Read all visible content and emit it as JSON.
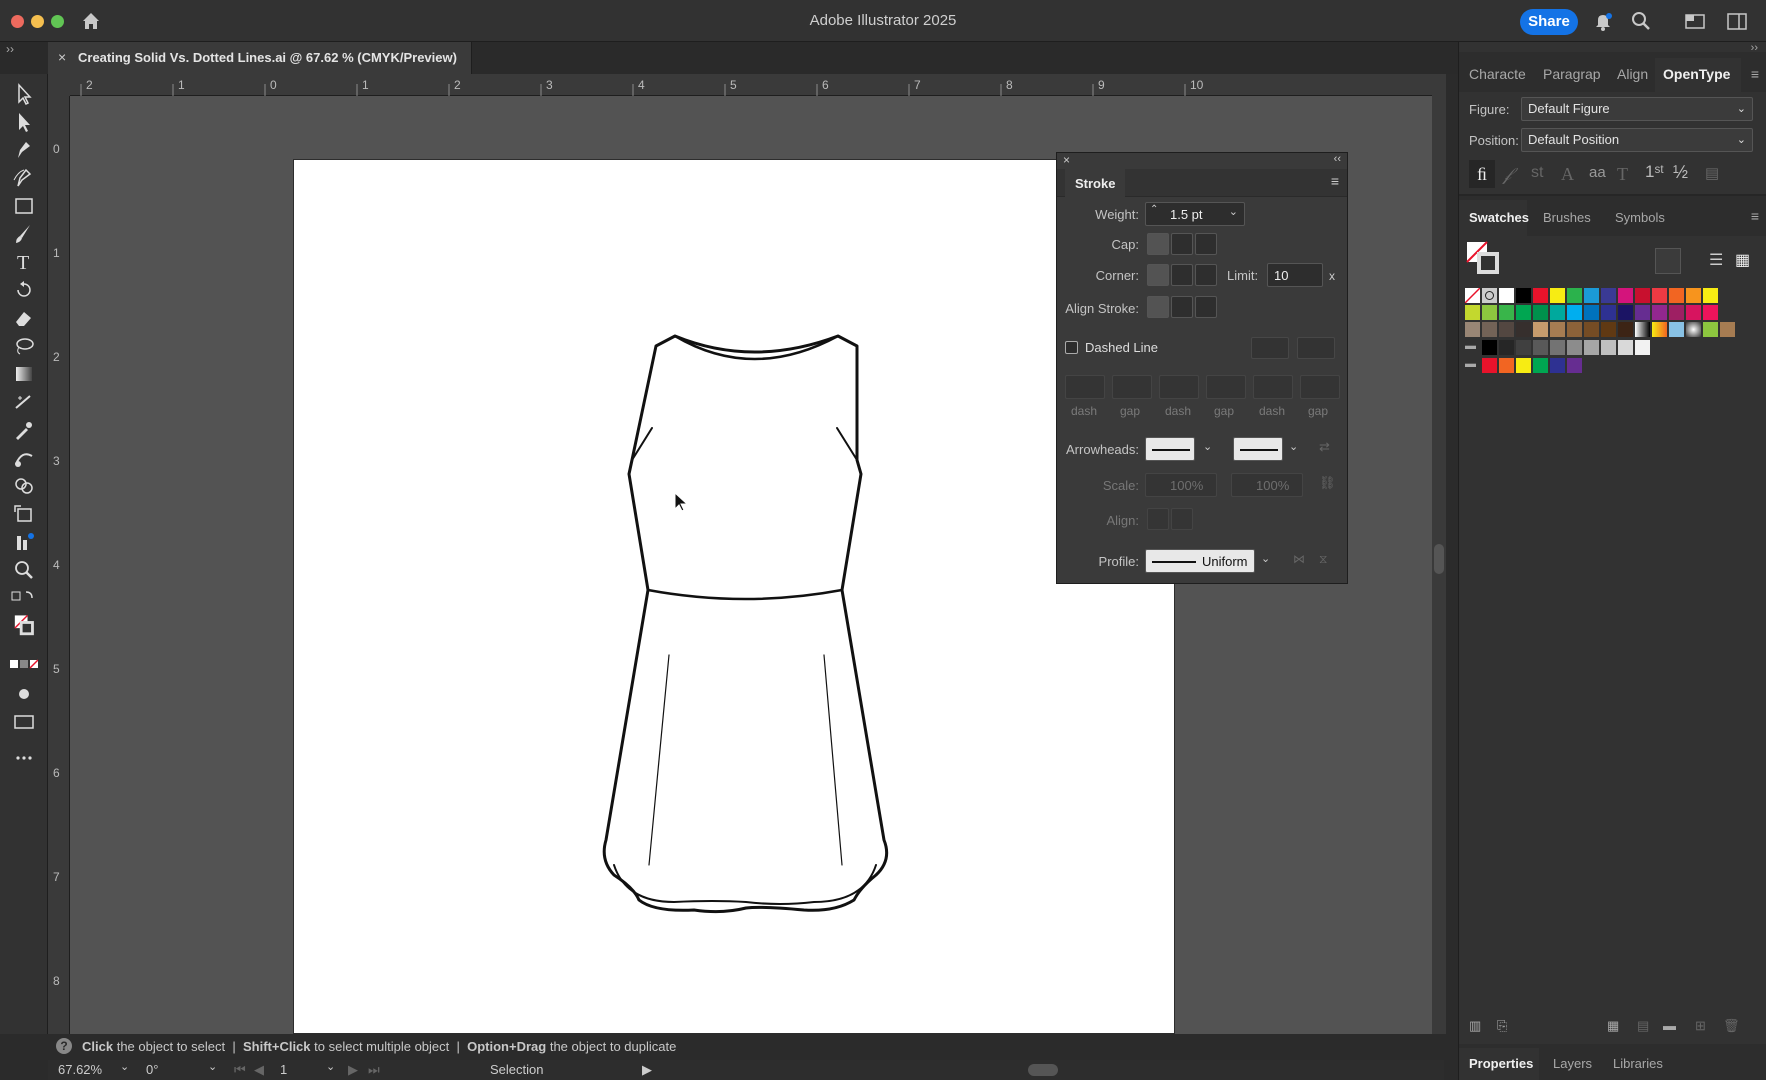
{
  "window": {
    "title": "Adobe Illustrator 2025",
    "share_label": "Share"
  },
  "document_tab": {
    "close": "×",
    "title": "Creating Solid Vs. Dotted Lines.ai @ 67.62 % (CMYK/Preview)"
  },
  "rulers": {
    "top": [
      "2",
      "1",
      "0",
      "1",
      "2",
      "3",
      "4",
      "5",
      "6",
      "7",
      "8",
      "9",
      "10"
    ],
    "left": [
      "0",
      "1",
      "2",
      "3",
      "4",
      "5",
      "6",
      "7",
      "8"
    ]
  },
  "stroke_panel": {
    "title": "Stroke",
    "weight_label": "Weight:",
    "weight_value": "1.5 pt",
    "cap_label": "Cap:",
    "corner_label": "Corner:",
    "limit_label": "Limit:",
    "limit_value": "10",
    "limit_unit": "x",
    "align_stroke_label": "Align Stroke:",
    "dashed_line_label": "Dashed Line",
    "dashed_line_checked": false,
    "dash_fields": [
      "dash",
      "gap",
      "dash",
      "gap",
      "dash",
      "gap"
    ],
    "arrowheads_label": "Arrowheads:",
    "scale_label": "Scale:",
    "scale_start": "100%",
    "scale_end": "100%",
    "align_label": "Align:",
    "profile_label": "Profile:",
    "profile_value": "Uniform"
  },
  "right_panel": {
    "top_tabs": [
      "Characte",
      "Paragrap",
      "Align",
      "OpenType"
    ],
    "active_top_tab": "OpenType",
    "figure_label": "Figure:",
    "figure_value": "Default Figure",
    "position_label": "Position:",
    "position_value": "Default Position",
    "swatch_tabs": [
      "Swatches",
      "Brushes",
      "Symbols"
    ],
    "active_swatch_tab": "Swatches",
    "bottom_tabs": [
      "Properties",
      "Layers",
      "Libraries"
    ],
    "active_bottom_tab": "Properties",
    "swatch_rows": [
      [
        "#ffffff",
        "#000000",
        "#e8132b",
        "#f7ec13",
        "#2bb24c",
        "#1b9ad6",
        "#3a3a94",
        "#d4147c",
        "#e8132b",
        "#ee3a43",
        "#f26522",
        "#f7941d",
        "#f7ec13"
      ],
      [
        "#c3d82e",
        "#8dc63f",
        "#39b54a",
        "#00a651",
        "#00a99d",
        "#00aeef",
        "#0072bc",
        "#2e3192",
        "#662d91",
        "#92278f",
        "#9e1f63",
        "#d7145f",
        "#ed145b"
      ],
      [
        "#998675",
        "#736357",
        "#534741",
        "#c69c6d",
        "#a67c52",
        "#8c6239",
        "#754c24",
        "#603913",
        "#3c2415",
        "#ffffff",
        "#f7941d",
        "#89c2e5",
        "#ffffff",
        "#8dc63f",
        "#a67c52"
      ],
      [
        "#000000",
        "#262626",
        "#404040",
        "#595959",
        "#737373",
        "#8c8c8c",
        "#a6a6a6",
        "#bfbfbf",
        "#d9d9d9",
        "#f2f2f2"
      ],
      [
        "#e8132b",
        "#f26522",
        "#f7ec13",
        "#00a651",
        "#2e3192",
        "#662d91"
      ]
    ]
  },
  "status": {
    "hint_click": "Click",
    "hint_click_text": "the object to select",
    "hint_shift": "Shift+Click",
    "hint_shift_text": "to select multiple object",
    "hint_option": "Option+Drag",
    "hint_option_text": "the object to duplicate",
    "sep": "|",
    "zoom": "67.62%",
    "rotation": "0°",
    "artboard": "1",
    "tool_name": "Selection"
  },
  "colors": {
    "accent": "#1473e6",
    "canvas": "#535353",
    "panel": "#323232"
  }
}
